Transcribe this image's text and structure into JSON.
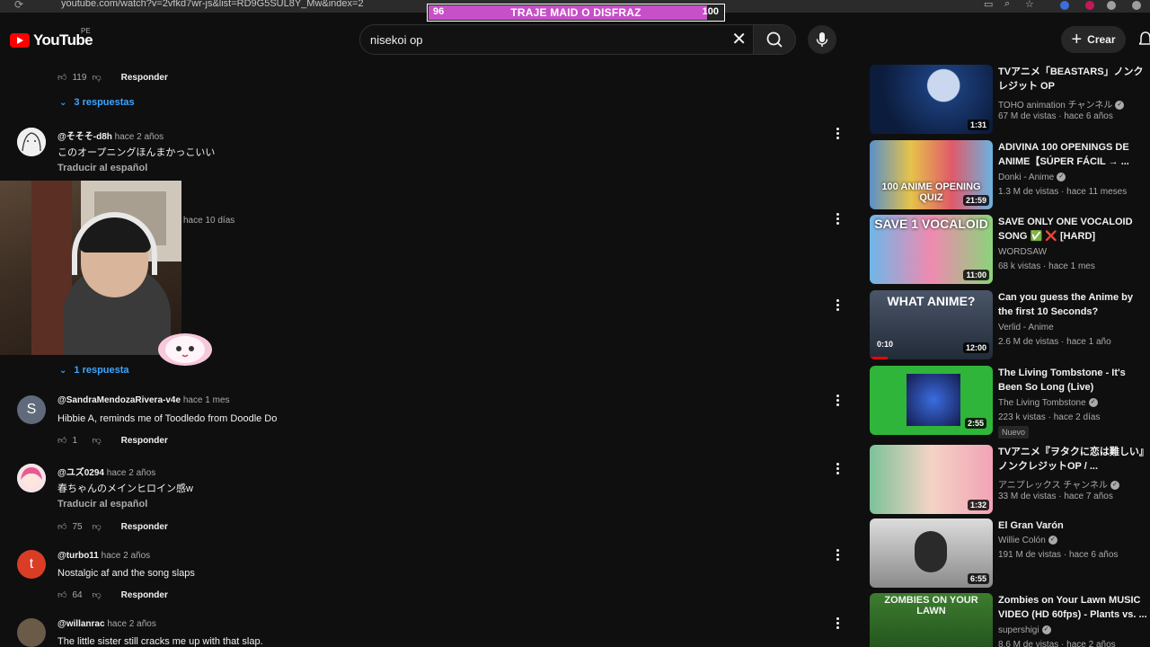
{
  "browser": {
    "url": "youtube.com/watch?v=2vfkd7wr-js&list=RD9G5SUL8Y_Mw&index=2"
  },
  "overlay": {
    "left_number": "96",
    "label": "TRAJE MAID O DISFRAZ",
    "right_number": "100",
    "progress": 0.96,
    "fill_color": "#c74fc7"
  },
  "header": {
    "logo_text": "YouTube",
    "country_code": "PE",
    "search_value": "nisekoi op",
    "create_label": "Crear",
    "brand_color": "#ff0000"
  },
  "comments": {
    "top_actions": {
      "likes": "119",
      "reply_label": "Responder"
    },
    "top_replies": "3 respuestas",
    "items": [
      {
        "author": "@そそそ-d8h",
        "time": "hace 2 años",
        "text": "このオープニングほんまかっこいい",
        "translate": "Traducir al español"
      },
      {
        "time": "hace 10 días",
        "replies": "1 respuesta"
      },
      {
        "author": "@SandraMendozaRivera-v4e",
        "time": "hace 1 mes",
        "text": "Hibbie A, reminds me of Toodledo from Doodle Do",
        "likes": "1",
        "reply_label": "Responder",
        "avatar_letter": "S"
      },
      {
        "author": "@ユズ0294",
        "time": "hace 2 años",
        "text": "春ちゃんのメインヒロイン感w",
        "translate": "Traducir al español",
        "likes": "75",
        "reply_label": "Responder"
      },
      {
        "author": "@turbo11",
        "time": "hace 2 años",
        "text": "Nostalgic af and the song slaps",
        "likes": "64",
        "reply_label": "Responder",
        "avatar_letter": "t"
      },
      {
        "author": "@willanrac",
        "time": "hace 2 años",
        "text": "The little sister still cracks me up with that slap."
      }
    ]
  },
  "sidebar": {
    "videos": [
      {
        "title": "TVアニメ「BEASTARS」ノンクレジット OP",
        "channel": "TOHO animation チャンネル",
        "verified": true,
        "views": "67 M de vistas",
        "age": "hace 6 años",
        "duration": "1:31"
      },
      {
        "title": "ADIVINA 100 OPENINGS DE ANIME【SÚPER FÁCIL → ...",
        "channel": "Donki - Anime",
        "verified": true,
        "views": "1.3 M de vistas",
        "age": "hace 11 meses",
        "duration": "21:59",
        "thumb_caption": "100 ANIME OPENING QUIZ"
      },
      {
        "title": "SAVE ONLY ONE VOCALOID SONG ✅ ❌ [HARD]",
        "channel": "WORDSAW",
        "verified": false,
        "views": "68 k vistas",
        "age": "hace 1 mes",
        "duration": "11:00",
        "thumb_caption": "SAVE 1 VOCALOID"
      },
      {
        "title": "Can you guess the Anime by the first 10 Seconds?",
        "channel": "Verlid - Anime",
        "verified": false,
        "views": "2.6 M de vistas",
        "age": "hace 1 año",
        "duration": "12:00",
        "progress_time": "0:10",
        "thumb_caption": "WHAT ANIME?"
      },
      {
        "title": "The Living Tombstone - It's Been So Long (Live)",
        "channel": "The Living Tombstone",
        "verified": true,
        "views": "223 k vistas",
        "age": "hace 2 días",
        "duration": "2:55",
        "badge": "Nuevo"
      },
      {
        "title": "TVアニメ『ヲタクに恋は難しい』ノンクレジットOP / ...",
        "channel": "アニプレックス チャンネル",
        "verified": true,
        "views": "33 M de vistas",
        "age": "hace 7 años",
        "duration": "1:32"
      },
      {
        "title": "El Gran Varón",
        "channel": "Willie Colón",
        "verified": true,
        "views": "191 M de vistas",
        "age": "hace 6 años",
        "duration": "6:55"
      },
      {
        "title": "Zombies on Your Lawn MUSIC VIDEO (HD 60fps) - Plants vs. ...",
        "channel": "supershigi",
        "verified": true,
        "views": "8.6 M de vistas",
        "age": "hace 2 años",
        "thumb_caption": "ZOMBIES ON YOUR LAWN"
      }
    ]
  }
}
